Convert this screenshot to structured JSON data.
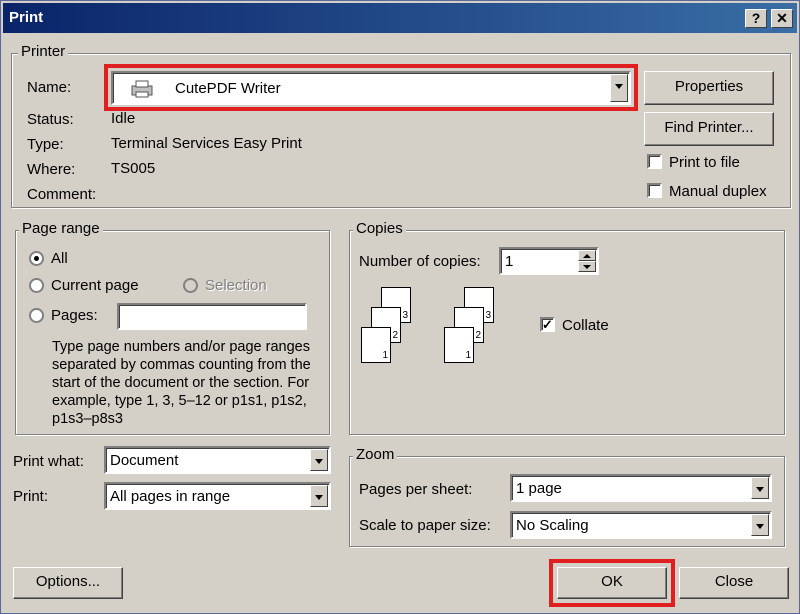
{
  "title": "Print",
  "title_buttons": {
    "help": "?",
    "close": "✕"
  },
  "printer": {
    "group_label": "Printer",
    "name_label": "Name:",
    "name_value": "CutePDF Writer",
    "status_label": "Status:",
    "status_value": "Idle",
    "type_label": "Type:",
    "type_value": "Terminal Services Easy Print",
    "where_label": "Where:",
    "where_value": "TS005",
    "comment_label": "Comment:",
    "properties_button": "Properties",
    "find_printer_button": "Find Printer...",
    "print_to_file_label": "Print to file",
    "print_to_file_checked": false,
    "manual_duplex_label": "Manual duplex",
    "manual_duplex_checked": false
  },
  "page_range": {
    "group_label": "Page range",
    "all_label": "All",
    "current_page_label": "Current page",
    "selection_label": "Selection",
    "pages_label": "Pages:",
    "pages_value": "",
    "selected": "All",
    "help_text": "Type page numbers and/or page ranges separated by commas counting from the start of the document or the section. For example, type 1, 3, 5–12 or p1s1, p1s2, p1s3–p8s3"
  },
  "copies": {
    "group_label": "Copies",
    "number_label": "Number of copies:",
    "number_value": "1",
    "collate_label": "Collate",
    "collate_checked": true,
    "page_numbers": [
      "1",
      "2",
      "3"
    ]
  },
  "print_what": {
    "label": "Print what:",
    "value": "Document"
  },
  "print": {
    "label": "Print:",
    "value": "All pages in range"
  },
  "zoom": {
    "group_label": "Zoom",
    "pages_per_sheet_label": "Pages per sheet:",
    "pages_per_sheet_value": "1 page",
    "scale_label": "Scale to paper size:",
    "scale_value": "No Scaling"
  },
  "footer": {
    "options_button": "Options...",
    "ok_button": "OK",
    "close_button": "Close"
  },
  "colors": {
    "highlight": "#e02020",
    "titlebar": "#0a246a",
    "dialog_bg": "#d4d0c8"
  },
  "icons": {
    "printer": "printer-icon"
  }
}
